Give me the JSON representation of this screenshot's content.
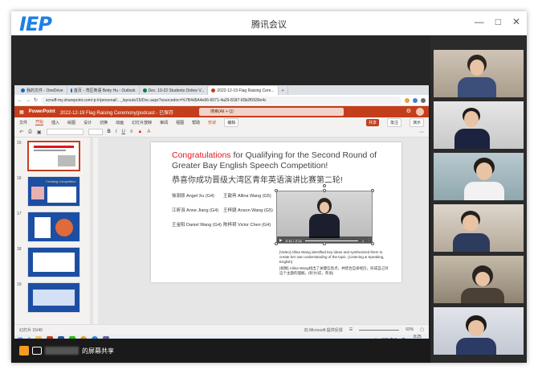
{
  "meeting": {
    "logo": "IEP",
    "title": "腾讯会议",
    "share_label": "的屏幕共享"
  },
  "browser": {
    "tabs": [
      {
        "label": "我的文件 - OneDrive",
        "color": "#0f6cbd"
      },
      {
        "label": "首页 - 湾区英语 Betty Hu - Outlook",
        "color": "#0f6cbd"
      },
      {
        "label": "Dec. 19-22 Students Online V...",
        "color": "#107c41"
      },
      {
        "label": "2022-12-19 Flag Raising Cere...",
        "color": "#c43e1c"
      }
    ],
    "new_tab": "+",
    "url": "scnuff-my.sharepoint.com/:p:/r/personal/..._layouts/15/Doc.aspx?sourcedoc=%7B4d5A4e66-6071-4a29-8187-60b2f0930e4c"
  },
  "ppt": {
    "app_name": "PowerPoint",
    "doc_title": "2022-12-19 Flag Raising Ceremony(podcast - 已保存",
    "search_placeholder": "搜索(Alt + Q)",
    "ribbon_tabs": [
      "文件",
      "开始",
      "插入",
      "绘图",
      "设计",
      "切换",
      "动画",
      "幻灯片放映",
      "审阅",
      "视图",
      "帮助",
      "形状"
    ],
    "active_tab": "开始",
    "edit_label": "编辑",
    "share_label": "共享",
    "comment_label": "批注",
    "present_label": "演示",
    "thumbnail_numbers": [
      "15",
      "16",
      "17",
      "18",
      "19"
    ],
    "thumb_labels": [
      "",
      "Creating Competition",
      "",
      "",
      ""
    ],
    "status_text": "幻灯片 15/40",
    "zoom": "60%",
    "feedback": "向 Microsoft 提供反馈"
  },
  "slide": {
    "title_red": "Congratulations",
    "title_rest": " for Qualifying for the Second Round of Greater Bay English Speech Competition!",
    "title_cn": "恭喜你成功晋级大湾区青年英语演讲比赛第二轮!",
    "winners": [
      {
        "name": "徐澍原 Angel Xu (G4)"
      },
      {
        "name": "王歆冉 Allina Wang (G5)"
      },
      {
        "name": "江昕羽 Anne Jiang (G4)"
      },
      {
        "name": "王梓骁 Anson Wang (G5)"
      },
      {
        "name": "王金阳 Daniel Wang (G4)"
      },
      {
        "name": "陈梓玥 Victor Chen (G4)"
      }
    ],
    "video_time": "2:11 / 2:11",
    "notes": [
      "[Video] Allina Wang identified key ideas and synthesized them to create her own understanding of the topic. (Listening & Speaking, English)",
      "[视频] Allina Wang找出了关键信息点，并结合自身经历，形成自己对这个主题的理解。(听力/说，英语)"
    ]
  },
  "taskbar": {
    "temperature": "6°C 多云",
    "time": "8:25",
    "date": "2022/12/19",
    "lang": "中"
  },
  "colors": {
    "ppt_red": "#c43e1c",
    "accent_blue": "#1e7fe6"
  }
}
